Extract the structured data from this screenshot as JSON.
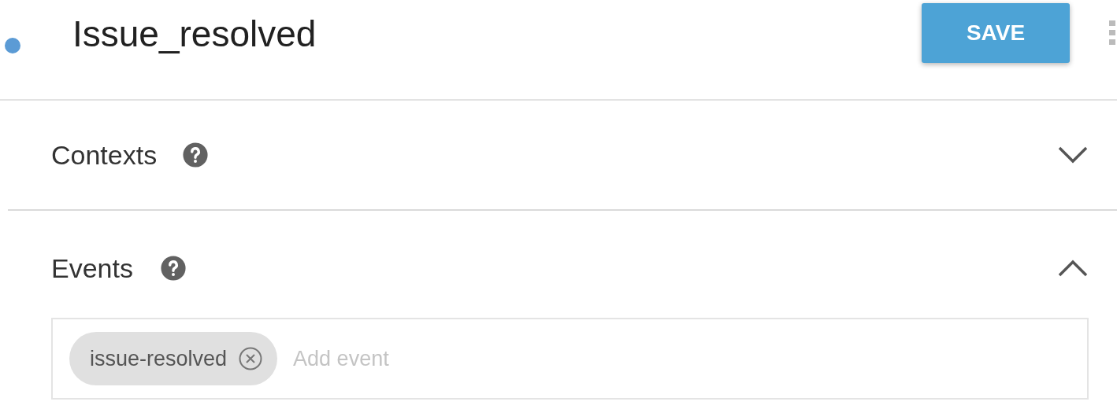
{
  "intent": {
    "title": "Issue_resolved"
  },
  "save_button": {
    "label": "SAVE"
  },
  "sections": [
    {
      "title": "Contexts",
      "expanded": false
    },
    {
      "title": "Events",
      "expanded": true,
      "chips": [
        {
          "label": "issue-resolved"
        }
      ],
      "placeholder": "Add event"
    }
  ]
}
